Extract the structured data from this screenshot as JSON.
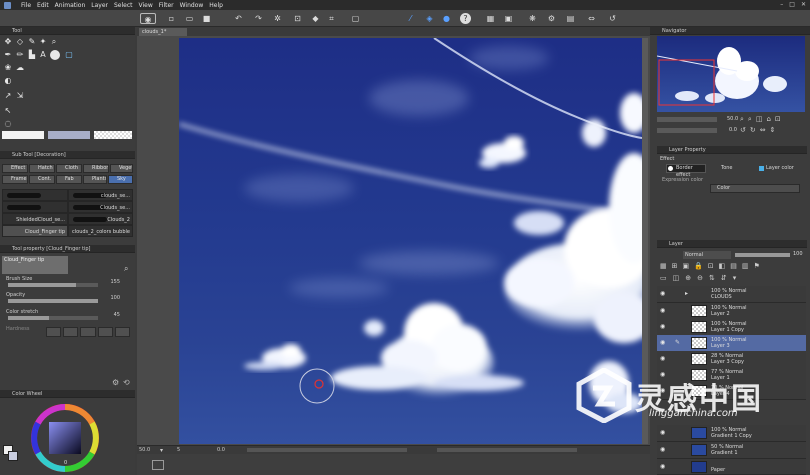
{
  "menubar": {
    "items": [
      "File",
      "Edit",
      "Animation",
      "Layer",
      "Select",
      "View",
      "Filter",
      "Window",
      "Help"
    ],
    "window_controls": [
      "–",
      "□",
      "✕"
    ]
  },
  "toolbar": {
    "icons": [
      "view-icon",
      "new-icon",
      "open-icon",
      "save-icon",
      "undo-icon",
      "redo-icon",
      "transform-icon",
      "clear-icon",
      "fill-icon",
      "crop-icon",
      "snap-icon",
      "ruler-icon",
      "symmetry-icon",
      "help-icon",
      "grid-icon",
      "color-icon",
      "settings-icon",
      "flip-icon",
      "rotate-icon"
    ]
  },
  "left": {
    "tool_panel_title": "Tool",
    "subtool_title": "Sub Tool [Decoration]",
    "subtool_tabs": [
      "Effect",
      "Hatch",
      "Cloth",
      "Ribbon",
      "Vegetation",
      "Frame",
      "Cont.",
      "Fab",
      "Plants",
      "Sky"
    ],
    "brushes": [
      {
        "left": "",
        "right": "clouds_se..."
      },
      {
        "left": "",
        "right": "Clouds_se..."
      },
      {
        "left": "ShieldedCloud_se...",
        "right": "Clouds_2"
      },
      {
        "left": "Cloud_Finger tip",
        "right": "clouds_2_colors bubble"
      }
    ],
    "tool_property_title": "Tool property [Cloud_Finger tip]",
    "tool_name": "Cloud_Finger tip",
    "props": [
      {
        "label": "Brush Size",
        "value": "155",
        "fill": 0.75
      },
      {
        "label": "Opacity",
        "value": "100",
        "fill": 1.0
      },
      {
        "label": "Color stretch",
        "value": "45",
        "fill": 0.45
      },
      {
        "label": "Hardness",
        "value": "",
        "fill": 0
      }
    ],
    "color_wheel_title": "Color Wheel",
    "color_value": "0"
  },
  "canvas": {
    "tab_title": "clouds_1*",
    "zoom": "50.0",
    "angle": "0.0",
    "status_value": "5"
  },
  "right": {
    "navigator_title": "Navigator",
    "nav_zoom": "50.0",
    "nav_angle": "0.0",
    "layer_property_title": "Layer Property",
    "effect_label": "Effect",
    "effect_options": [
      "Border effect",
      "Tone",
      "Layer color"
    ],
    "expression_color_label": "Expression color",
    "expression_color_value": "Color",
    "layer_panel_title": "Layer",
    "blend_mode": "Normal",
    "opacity_value": "100",
    "folder": {
      "line1": "100 % Normal",
      "line2": "CLOUDS"
    },
    "layers": [
      {
        "line1": "100 % Normal",
        "line2": "Layer 2",
        "selected": false
      },
      {
        "line1": "100 % Normal",
        "line2": "Layer 1 Copy",
        "selected": false
      },
      {
        "line1": "100 % Normal",
        "line2": "Layer 3",
        "selected": true
      },
      {
        "line1": "28 % Normal",
        "line2": "Layer 3 Copy",
        "selected": false
      },
      {
        "line1": "77 % Normal",
        "line2": "Layer 1",
        "selected": false
      },
      {
        "line1": "70 % Normal",
        "line2": "Layer 4",
        "selected": false
      },
      {
        "line1": "100 % Normal",
        "line2": "Gradient 1 Copy",
        "selected": false
      },
      {
        "line1": "50 % Normal",
        "line2": "Gradient 1",
        "selected": false
      },
      {
        "line1": "",
        "line2": "Paper",
        "selected": false
      }
    ]
  },
  "watermark": {
    "cn": "灵感中国",
    "url": "lingganchina.com"
  },
  "colors": {
    "accent": "#546aa3",
    "sky_top": "#1e2e86",
    "sky_bottom": "#3350a0",
    "panel_bg": "#3c3c3c"
  }
}
